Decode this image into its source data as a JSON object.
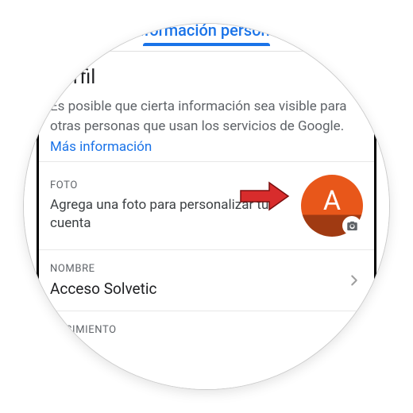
{
  "tab": {
    "label": "Información personal"
  },
  "profile": {
    "heading": "Perfil",
    "description": "Es posible que cierta información sea visible para otras personas que usan los servicios de Google.",
    "more_link": "Más información"
  },
  "photo": {
    "label": "FOTO",
    "hint": "Agrega una foto para personalizar tu cuenta",
    "avatar_letter": "A"
  },
  "name": {
    "label": "NOMBRE",
    "value": "Acceso Solvetic"
  },
  "birth": {
    "label": "NACIMIENTO"
  }
}
